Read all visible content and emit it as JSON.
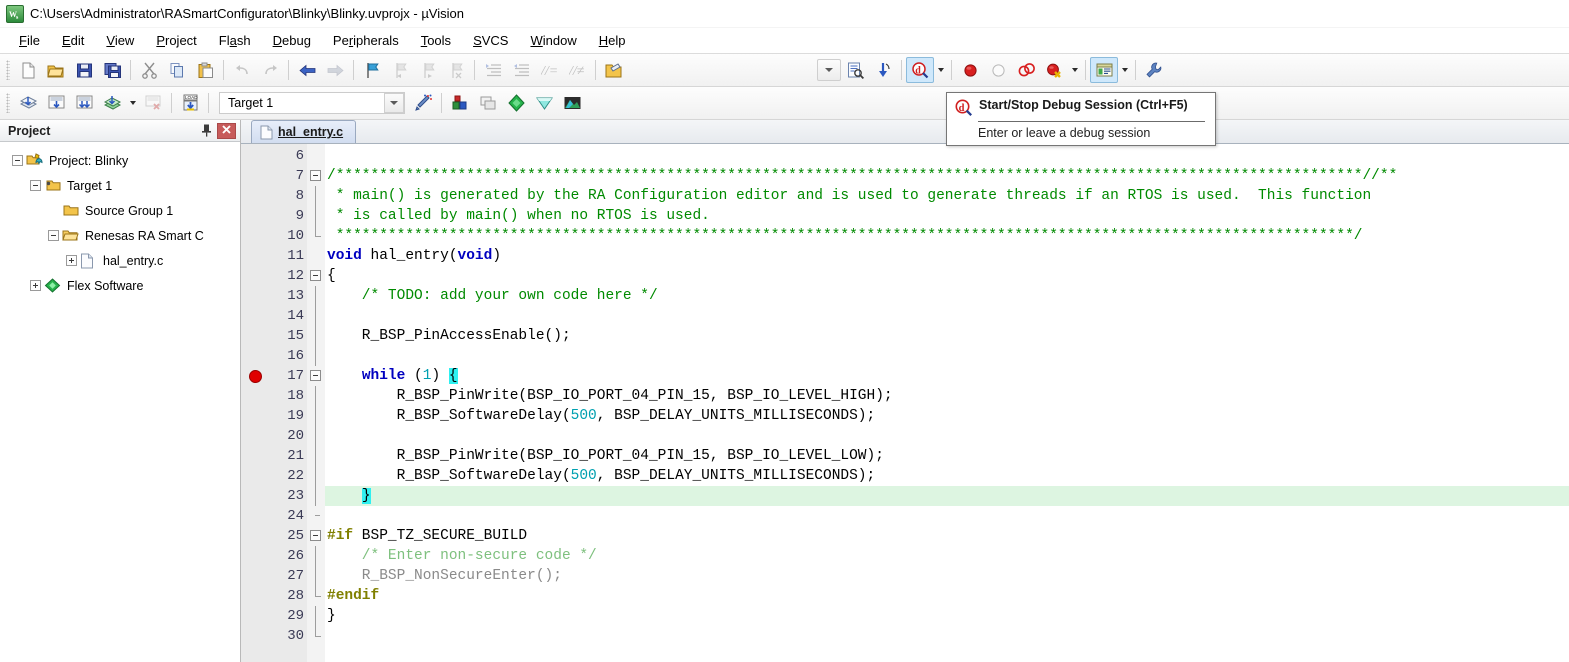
{
  "window": {
    "title": "C:\\Users\\Administrator\\RASmartConfigurator\\Blinky\\Blinky.uvprojx - µVision",
    "app_icon_text": "μVs"
  },
  "menubar": {
    "items": [
      {
        "label": "File",
        "mnemonic": "F"
      },
      {
        "label": "Edit",
        "mnemonic": "E"
      },
      {
        "label": "View",
        "mnemonic": "V"
      },
      {
        "label": "Project",
        "mnemonic": "P"
      },
      {
        "label": "Flash",
        "mnemonic": "a"
      },
      {
        "label": "Debug",
        "mnemonic": "D"
      },
      {
        "label": "Peripherals",
        "mnemonic": "r"
      },
      {
        "label": "Tools",
        "mnemonic": "T"
      },
      {
        "label": "SVCS",
        "mnemonic": "S"
      },
      {
        "label": "Window",
        "mnemonic": "W"
      },
      {
        "label": "Help",
        "mnemonic": "H"
      }
    ]
  },
  "toolbar_main": {
    "buttons": [
      {
        "name": "new-file-icon",
        "tip": "New"
      },
      {
        "name": "open-file-icon",
        "tip": "Open"
      },
      {
        "name": "save-icon",
        "tip": "Save"
      },
      {
        "name": "save-all-icon",
        "tip": "Save All"
      },
      {
        "name": "cut-icon",
        "tip": "Cut"
      },
      {
        "name": "copy-icon",
        "tip": "Copy"
      },
      {
        "name": "paste-icon",
        "tip": "Paste"
      },
      {
        "name": "undo-icon",
        "tip": "Undo"
      },
      {
        "name": "redo-icon",
        "tip": "Redo"
      },
      {
        "name": "navigate-back-icon",
        "tip": "Back"
      },
      {
        "name": "navigate-forward-icon",
        "tip": "Forward"
      },
      {
        "name": "bookmark-toggle-icon",
        "tip": "Toggle Bookmark"
      },
      {
        "name": "bookmark-prev-icon",
        "tip": "Previous Bookmark"
      },
      {
        "name": "bookmark-next-icon",
        "tip": "Next Bookmark"
      },
      {
        "name": "bookmark-clear-icon",
        "tip": "Clear Bookmarks"
      },
      {
        "name": "indent-right-icon",
        "tip": "Indent"
      },
      {
        "name": "indent-left-icon",
        "tip": "Outdent"
      },
      {
        "name": "comment-icon",
        "tip": "Comment"
      },
      {
        "name": "uncomment-icon",
        "tip": "Uncomment"
      },
      {
        "name": "open-folder-ext-icon",
        "tip": "Open Containing Folder"
      }
    ],
    "right_buttons": [
      {
        "name": "dropdown-arrow-icon",
        "tip": ""
      },
      {
        "name": "find-in-files-icon",
        "tip": "Find in Files"
      },
      {
        "name": "configure-icon",
        "tip": "Configure"
      },
      {
        "name": "start-stop-debug-icon",
        "tip": "Start/Stop Debug Session"
      },
      {
        "name": "insert-breakpoint-icon",
        "tip": "Insert/Remove Breakpoint"
      },
      {
        "name": "enable-breakpoint-icon",
        "tip": "Enable/Disable Breakpoint"
      },
      {
        "name": "disable-all-breakpoints-icon",
        "tip": "Disable All Breakpoints"
      },
      {
        "name": "kill-all-breakpoints-icon",
        "tip": "Kill All Breakpoints"
      },
      {
        "name": "manage-windows-icon",
        "tip": "Manage Windows"
      },
      {
        "name": "configure-target-icon",
        "tip": "Options for Target"
      }
    ]
  },
  "toolbar_build": {
    "buttons": [
      {
        "name": "translate-icon",
        "tip": "Translate"
      },
      {
        "name": "build-icon",
        "tip": "Build"
      },
      {
        "name": "rebuild-icon",
        "tip": "Rebuild"
      },
      {
        "name": "batch-build-icon",
        "tip": "Batch Build"
      },
      {
        "name": "stop-build-icon",
        "tip": "Stop Build"
      },
      {
        "name": "download-icon",
        "tip": "Download"
      }
    ],
    "target_selector": {
      "value": "Target 1",
      "name": "target-select"
    },
    "right_buttons": [
      {
        "name": "target-options-wizard-icon",
        "tip": "Options for Target"
      },
      {
        "name": "manage-rte-icon",
        "tip": "Manage Run-Time Environment"
      },
      {
        "name": "multi-project-icon",
        "tip": "Manage Multi-Project"
      },
      {
        "name": "pack-installer-green-icon",
        "tip": "Pack Installer"
      },
      {
        "name": "pack-installer-cyan-icon",
        "tip": "Pack Installer"
      },
      {
        "name": "smart-configurator-icon",
        "tip": "Smart Configurator"
      }
    ]
  },
  "tooltip": {
    "title": "Start/Stop Debug Session (Ctrl+F5)",
    "body": "Enter or leave a debug session",
    "icon": "start-stop-debug-icon"
  },
  "project_panel": {
    "title": "Project",
    "pin_icon": "pushpin-icon",
    "close_icon": "close-icon",
    "tree": [
      {
        "label": "Project: Blinky",
        "indent": 0,
        "expander": "minus",
        "icon": "project-icon"
      },
      {
        "label": "Target 1",
        "indent": 1,
        "expander": "minus",
        "icon": "target-folder-icon"
      },
      {
        "label": "Source Group 1",
        "indent": 2,
        "expander": "none",
        "icon": "folder-icon"
      },
      {
        "label": "Renesas RA Smart C",
        "indent": 2,
        "expander": "minus",
        "icon": "folder-icon"
      },
      {
        "label": "hal_entry.c",
        "indent": 3,
        "expander": "plus",
        "icon": "c-file-icon"
      },
      {
        "label": "Flex Software",
        "indent": 1,
        "expander": "plus",
        "icon": "flex-software-icon"
      }
    ]
  },
  "editor": {
    "tabs": [
      {
        "label": "hal_entry.c",
        "icon": "c-file-icon",
        "active": true
      }
    ],
    "first_line": 6,
    "breakpoint_lines": [
      17
    ],
    "highlighted_lines": [
      23
    ],
    "lines": [
      {
        "n": 6,
        "fold": "none",
        "tokens": [
          {
            "t": "",
            "c": "k-id"
          }
        ]
      },
      {
        "n": 7,
        "fold": "start",
        "tokens": [
          {
            "t": "/**********************************************************************************************************************//**",
            "c": "k-cmt"
          }
        ]
      },
      {
        "n": 8,
        "fold": "bar",
        "tokens": [
          {
            "t": " * main() is generated by the RA Configuration editor and is used to generate threads if an RTOS is used.  This function",
            "c": "k-cmt"
          }
        ]
      },
      {
        "n": 9,
        "fold": "bar",
        "tokens": [
          {
            "t": " * is called by main() when no RTOS is used.",
            "c": "k-cmt"
          }
        ]
      },
      {
        "n": 10,
        "fold": "end",
        "tokens": [
          {
            "t": " *********************************************************************************************************************/",
            "c": "k-cmt"
          }
        ]
      },
      {
        "n": 11,
        "fold": "none",
        "tokens": [
          {
            "t": "void",
            "c": "k-key"
          },
          {
            "t": " hal_entry(",
            "c": "k-id"
          },
          {
            "t": "void",
            "c": "k-key"
          },
          {
            "t": ")",
            "c": "k-id"
          }
        ]
      },
      {
        "n": 12,
        "fold": "start",
        "tokens": [
          {
            "t": "{",
            "c": "k-id"
          }
        ]
      },
      {
        "n": 13,
        "fold": "bar",
        "tokens": [
          {
            "t": "    /* TODO: add your own code here */",
            "c": "k-cmt"
          }
        ]
      },
      {
        "n": 14,
        "fold": "bar",
        "tokens": [
          {
            "t": "",
            "c": "k-id"
          }
        ]
      },
      {
        "n": 15,
        "fold": "bar",
        "tokens": [
          {
            "t": "    R_BSP_PinAccessEnable();",
            "c": "k-id"
          }
        ]
      },
      {
        "n": 16,
        "fold": "bar",
        "tokens": [
          {
            "t": "",
            "c": "k-id"
          }
        ]
      },
      {
        "n": 17,
        "fold": "start2",
        "tokens": [
          {
            "t": "    ",
            "c": "k-id"
          },
          {
            "t": "while",
            "c": "k-key"
          },
          {
            "t": " (",
            "c": "k-id"
          },
          {
            "t": "1",
            "c": "k-num"
          },
          {
            "t": ") ",
            "c": "k-id"
          },
          {
            "t": "{",
            "c": "k-brace-sel"
          }
        ]
      },
      {
        "n": 18,
        "fold": "bar",
        "tokens": [
          {
            "t": "        R_BSP_PinWrite(BSP_IO_PORT_04_PIN_15, BSP_IO_LEVEL_HIGH);",
            "c": "k-id"
          }
        ]
      },
      {
        "n": 19,
        "fold": "bar",
        "tokens": [
          {
            "t": "        R_BSP_SoftwareDelay(",
            "c": "k-id"
          },
          {
            "t": "500",
            "c": "k-num"
          },
          {
            "t": ", BSP_DELAY_UNITS_MILLISECONDS);",
            "c": "k-id"
          }
        ]
      },
      {
        "n": 20,
        "fold": "bar",
        "tokens": [
          {
            "t": "",
            "c": "k-id"
          }
        ]
      },
      {
        "n": 21,
        "fold": "bar",
        "tokens": [
          {
            "t": "        R_BSP_PinWrite(BSP_IO_PORT_04_PIN_15, BSP_IO_LEVEL_LOW);",
            "c": "k-id"
          }
        ]
      },
      {
        "n": 22,
        "fold": "bar",
        "tokens": [
          {
            "t": "        R_BSP_SoftwareDelay(",
            "c": "k-id"
          },
          {
            "t": "500",
            "c": "k-num"
          },
          {
            "t": ", BSP_DELAY_UNITS_MILLISECONDS);",
            "c": "k-id"
          }
        ]
      },
      {
        "n": 23,
        "fold": "bar",
        "tokens": [
          {
            "t": "    ",
            "c": "k-id"
          },
          {
            "t": "}",
            "c": "k-brace-sel"
          }
        ]
      },
      {
        "n": 24,
        "fold": "tick",
        "tokens": [
          {
            "t": "",
            "c": "k-id"
          }
        ]
      },
      {
        "n": 25,
        "fold": "start",
        "tokens": [
          {
            "t": "#if",
            "c": "k-pp"
          },
          {
            "t": " BSP_TZ_SECURE_BUILD",
            "c": "k-id"
          }
        ]
      },
      {
        "n": 26,
        "fold": "bar",
        "tokens": [
          {
            "t": "    /* Enter non-secure code */",
            "c": "k-cmt-dim"
          }
        ]
      },
      {
        "n": 27,
        "fold": "bar",
        "tokens": [
          {
            "t": "    R_BSP_NonSecureEnter();",
            "c": "k-dim"
          }
        ]
      },
      {
        "n": 28,
        "fold": "endtick",
        "tokens": [
          {
            "t": "#endif",
            "c": "k-pp"
          }
        ]
      },
      {
        "n": 29,
        "fold": "bar",
        "tokens": [
          {
            "t": "}",
            "c": "k-id"
          }
        ]
      },
      {
        "n": 30,
        "fold": "end",
        "tokens": [
          {
            "t": "",
            "c": "k-id"
          }
        ]
      }
    ]
  },
  "colors": {
    "comment": "#008a00",
    "comment_inactive": "#7ec07e",
    "keyword": "#0000c0",
    "number": "#00a0b0",
    "preprocessor": "#808000",
    "inactive_code": "#8a8a8a",
    "breakpoint": "#e00000",
    "brace_match": "#2ff0f0",
    "current_line": "#ddf5e1",
    "gutter": "#eaeaea"
  }
}
